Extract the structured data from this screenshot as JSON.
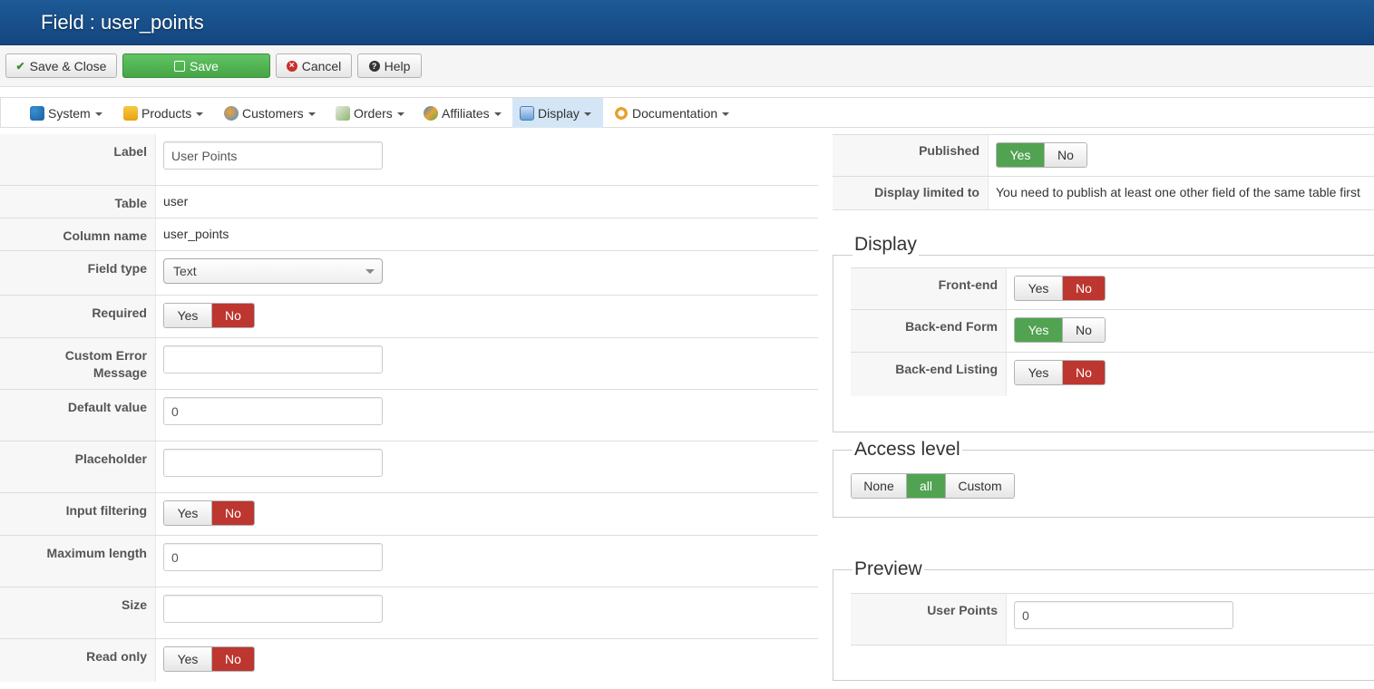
{
  "header": {
    "title": "Field : user_points"
  },
  "toolbar": {
    "save_close": "Save & Close",
    "save": "Save",
    "cancel": "Cancel",
    "help": "Help"
  },
  "menu": {
    "items": [
      {
        "label": "System",
        "icon": "tools-icon"
      },
      {
        "label": "Products",
        "icon": "box-icon"
      },
      {
        "label": "Customers",
        "icon": "users-icon"
      },
      {
        "label": "Orders",
        "icon": "orders-icon"
      },
      {
        "label": "Affiliates",
        "icon": "affiliates-icon"
      },
      {
        "label": "Display",
        "icon": "display-icon",
        "active": true
      },
      {
        "label": "Documentation",
        "icon": "lifebuoy-icon"
      }
    ]
  },
  "form": {
    "label": {
      "label": "Label",
      "value": "User Points"
    },
    "table": {
      "label": "Table",
      "value": "user"
    },
    "column_name": {
      "label": "Column name",
      "value": "user_points"
    },
    "field_type": {
      "label": "Field type",
      "value": "Text"
    },
    "required": {
      "label": "Required",
      "yes": "Yes",
      "no": "No",
      "selected": "No"
    },
    "custom_error": {
      "label_line1": "Custom Error",
      "label_line2": "Message",
      "value": ""
    },
    "default_value": {
      "label": "Default value",
      "value": "0"
    },
    "placeholder": {
      "label": "Placeholder",
      "value": ""
    },
    "input_filtering": {
      "label": "Input filtering",
      "yes": "Yes",
      "no": "No",
      "selected": "No"
    },
    "maximum_length": {
      "label": "Maximum length",
      "value": "0"
    },
    "size": {
      "label": "Size",
      "value": ""
    },
    "read_only": {
      "label": "Read only",
      "yes": "Yes",
      "no": "No",
      "selected": "No"
    }
  },
  "right": {
    "published": {
      "label": "Published",
      "yes": "Yes",
      "no": "No",
      "selected": "Yes"
    },
    "display_limited": {
      "label": "Display limited to",
      "value": "You need to publish at least one other field of the same table first"
    },
    "display": {
      "legend": "Display",
      "front_end": {
        "label": "Front-end",
        "yes": "Yes",
        "no": "No",
        "selected": "No"
      },
      "backend_form": {
        "label": "Back-end Form",
        "yes": "Yes",
        "no": "No",
        "selected": "Yes"
      },
      "backend_listing": {
        "label": "Back-end Listing",
        "yes": "Yes",
        "no": "No",
        "selected": "No"
      }
    },
    "access": {
      "legend": "Access level",
      "none": "None",
      "all": "all",
      "custom": "Custom",
      "selected": "all"
    },
    "preview": {
      "legend": "Preview",
      "label": "User Points",
      "value": "0"
    }
  },
  "colors": {
    "green": "#51a351",
    "red": "#bd362f",
    "header_blue": "#1d5a96",
    "menu_active": "#d4e6f6"
  }
}
